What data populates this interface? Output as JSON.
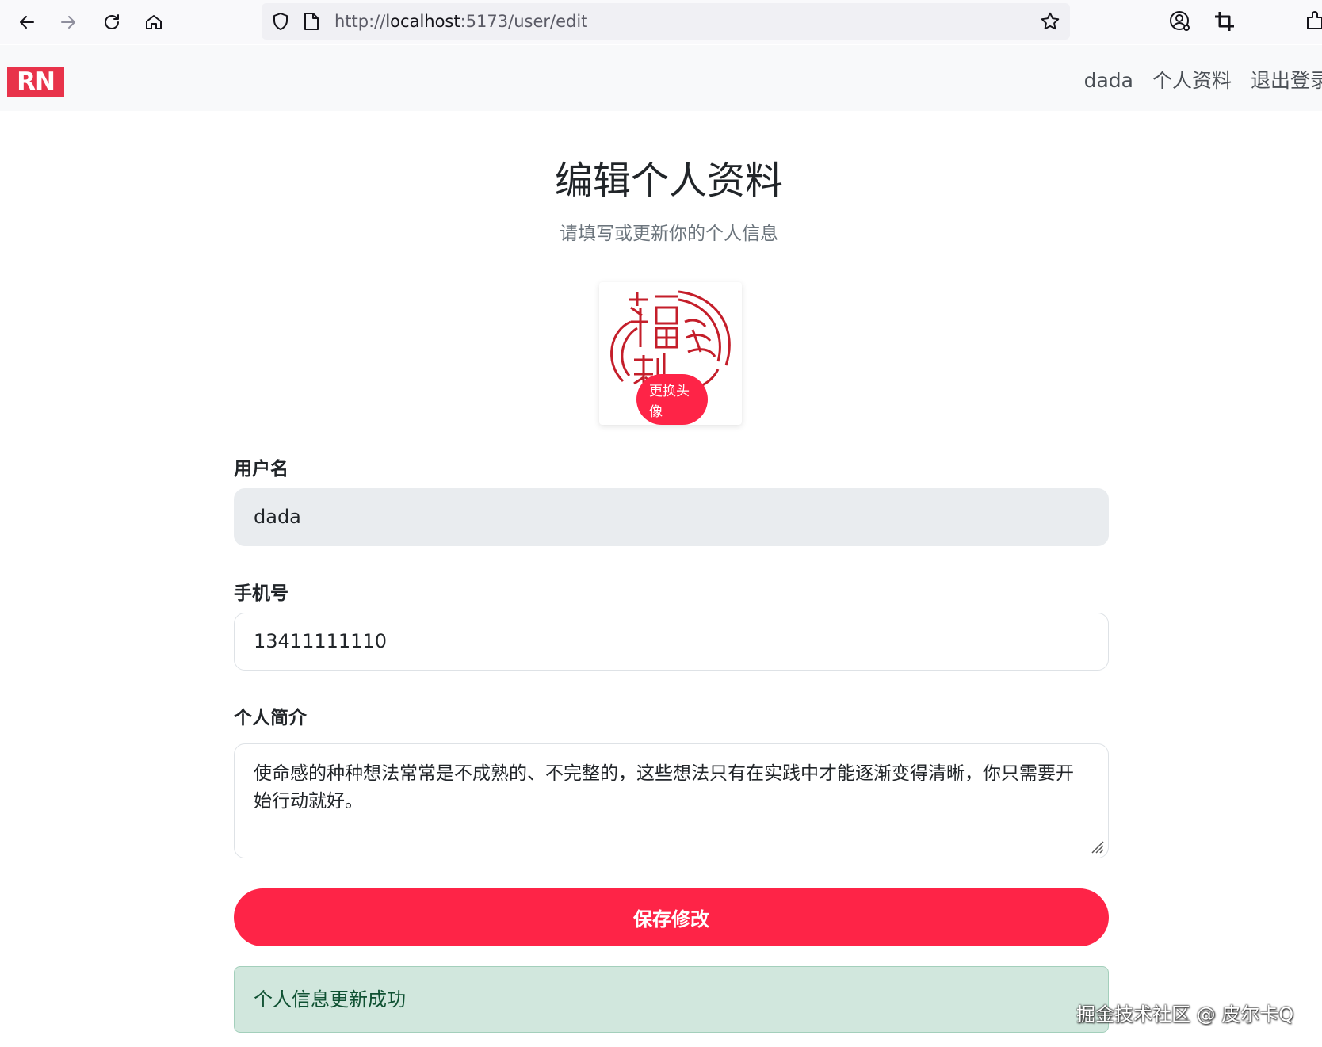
{
  "browser": {
    "url_scheme": "http://",
    "url_host": "localhost",
    "url_rest": ":5173/user/edit"
  },
  "navbar": {
    "logo_text": "RN",
    "username": "dada",
    "profile_link": "个人资料",
    "logout_link": "退出登录"
  },
  "page": {
    "title": "编辑个人资料",
    "subtitle": "请填写或更新你的个人信息"
  },
  "avatar": {
    "change_label": "更换头像",
    "image_text": "福多利"
  },
  "form": {
    "username_label": "用户名",
    "username_value": "dada",
    "phone_label": "手机号",
    "phone_value": "13411111110",
    "bio_label": "个人简介",
    "bio_value": "使命感的种种想法常常是不成熟的、不完整的，这些想法只有在实践中才能逐渐变得清晰，你只需要开始行动就好。",
    "save_label": "保存修改"
  },
  "alert": {
    "message": "个人信息更新成功"
  },
  "watermark": {
    "text": "掘金技术社区 @ 皮尔卡Q"
  },
  "colors": {
    "accent": "#fe2447",
    "logo": "#e8334a",
    "success_bg": "#d1e7dd",
    "success_text": "#0f5132"
  }
}
